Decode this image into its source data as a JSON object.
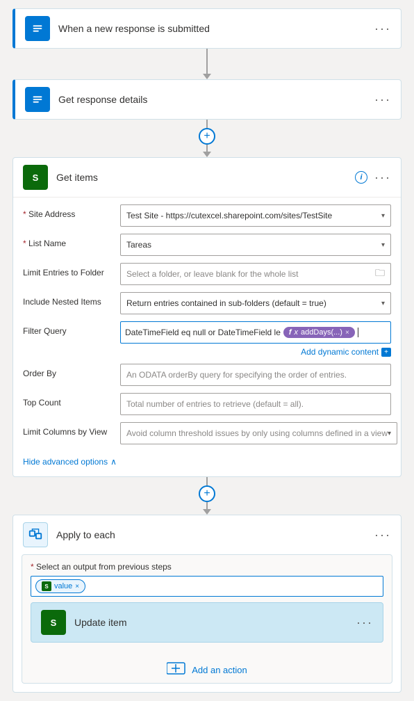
{
  "steps": {
    "step1": {
      "title": "When a new response is submitted",
      "iconColor": "#0078d4",
      "iconLabel": "F"
    },
    "step2": {
      "title": "Get response details",
      "iconColor": "#0078d4",
      "iconLabel": "F"
    },
    "step3": {
      "title": "Get items",
      "iconColor": "#0b6a0b",
      "iconLabel": "S"
    }
  },
  "getItems": {
    "header": "Get items",
    "fields": {
      "siteAddress": {
        "label": "Site Address",
        "required": true,
        "value": "Test Site - https://cutexcel.sharepoint.com/sites/TestSite",
        "hasChevron": true
      },
      "listName": {
        "label": "List Name",
        "required": true,
        "value": "Tareas",
        "hasChevron": true
      },
      "limitToFolder": {
        "label": "Limit Entries to Folder",
        "placeholder": "Select a folder, or leave blank for the whole list"
      },
      "includeNested": {
        "label": "Include Nested Items",
        "value": "Return entries contained in sub-folders (default = true)",
        "hasChevron": true
      },
      "filterQuery": {
        "label": "Filter Query",
        "prefixText": "DateTimeField eq null or DateTimeField le",
        "tokenLabel": "addDays(...)",
        "cursorVisible": true
      },
      "addDynamicContent": "Add dynamic content",
      "orderBy": {
        "label": "Order By",
        "placeholder": "An ODATA orderBy query for specifying the order of entries."
      },
      "topCount": {
        "label": "Top Count",
        "placeholder": "Total number of entries to retrieve (default = all)."
      },
      "limitColumnsByView": {
        "label": "Limit Columns by View",
        "placeholder": "Avoid column threshold issues by only using columns defined in a view",
        "hasChevron": true
      }
    },
    "hideAdvanced": "Hide advanced options"
  },
  "applyToEach": {
    "title": "Apply to each",
    "selectLabel": "Select an output from previous steps",
    "valueToken": "value",
    "updateItem": {
      "title": "Update item",
      "iconLabel": "S"
    },
    "addAction": "Add an action"
  },
  "icons": {
    "formsIcon": "≡",
    "chevronDown": "▾",
    "moreIcon": "···",
    "plusIcon": "+",
    "infoIcon": "i",
    "chevronUp": "∧",
    "folderIcon": "📁",
    "addActionTable": "⊞"
  }
}
